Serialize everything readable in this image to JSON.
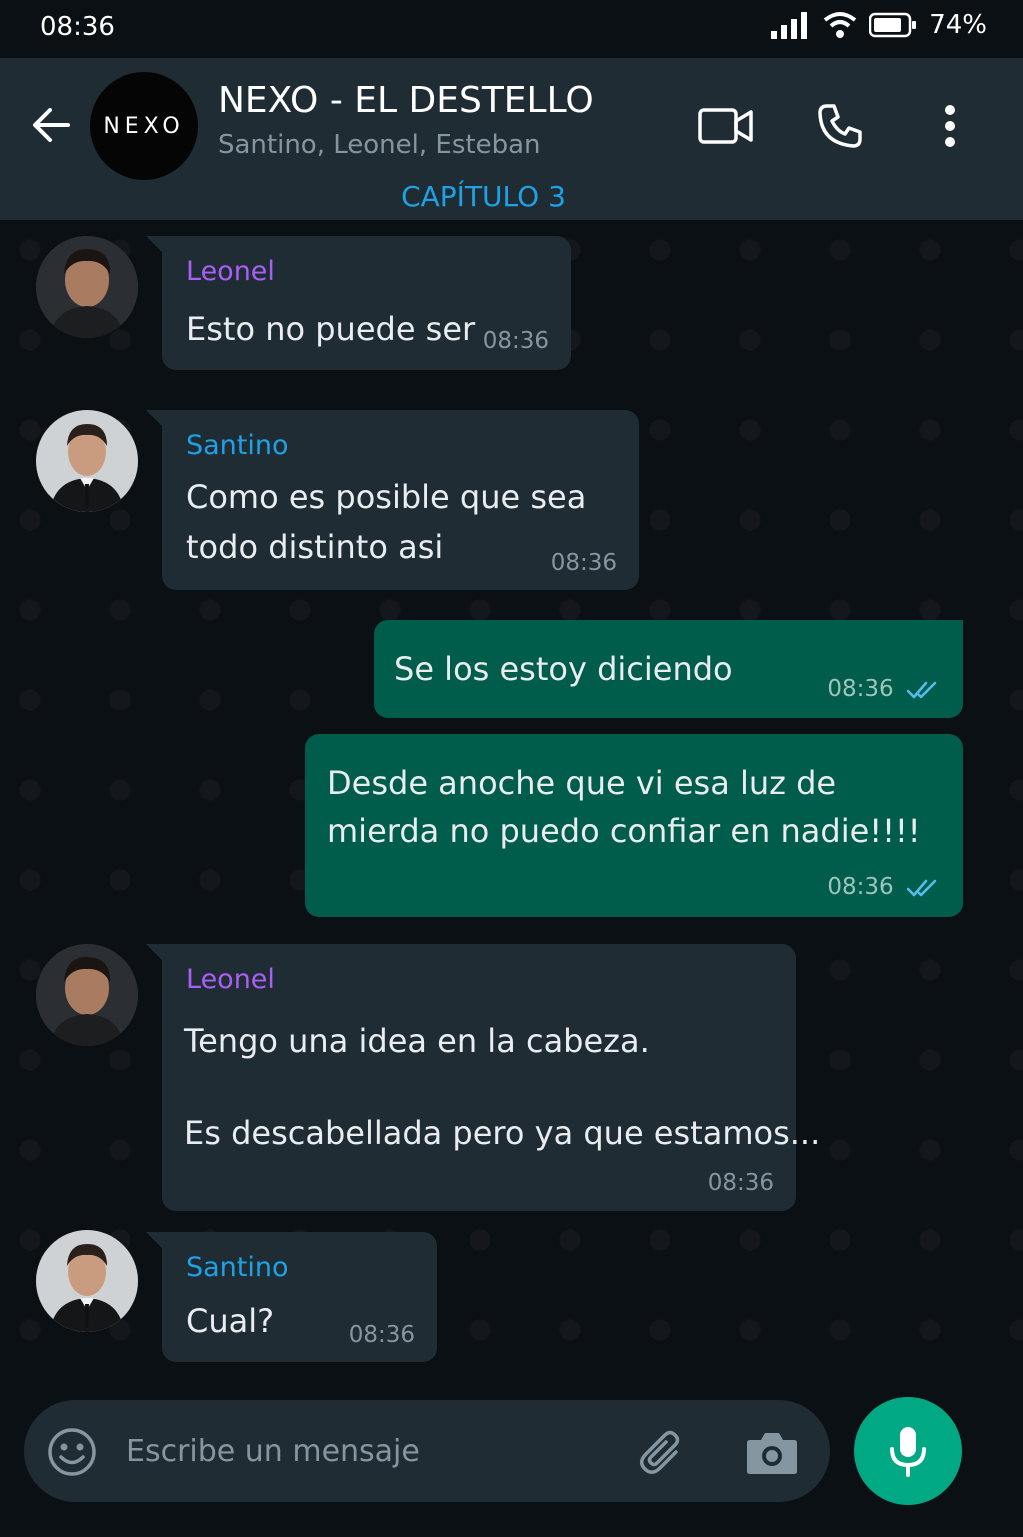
{
  "status_bar": {
    "time": "08:36",
    "battery": "74%"
  },
  "header": {
    "group_avatar_text": "NEXO",
    "title": "NEXO - EL DESTELLO",
    "subtitle": "Santino, Leonel, Esteban",
    "chapter": "CAPÍTULO 3"
  },
  "messages": [
    {
      "sender": "Leonel",
      "lines": [
        "Esto no puede ser"
      ],
      "time": "08:36"
    },
    {
      "sender": "Santino",
      "lines": [
        "Como es posible que sea",
        "todo distinto asi"
      ],
      "time": "08:36"
    },
    {
      "lines": [
        "Se los estoy diciendo"
      ],
      "time": "08:36"
    },
    {
      "lines": [
        "Desde anoche que vi esa luz de",
        "mierda no puedo confiar en nadie!!!!"
      ],
      "time": "08:36"
    },
    {
      "sender": "Leonel",
      "lines": [
        "Tengo una idea en la cabeza.",
        "",
        "Es descabellada pero ya que estamos..."
      ],
      "time": "08:36"
    },
    {
      "sender": "Santino",
      "lines": [
        "Cual?"
      ],
      "time": "08:36"
    }
  ],
  "composer": {
    "placeholder": "Escribe un mensaje"
  },
  "colors": {
    "leonel": "#a95ff5",
    "santino": "#1fa1e6",
    "incoming": "#1f2c34",
    "outgoing": "#005c4b",
    "accent": "#00a884"
  }
}
